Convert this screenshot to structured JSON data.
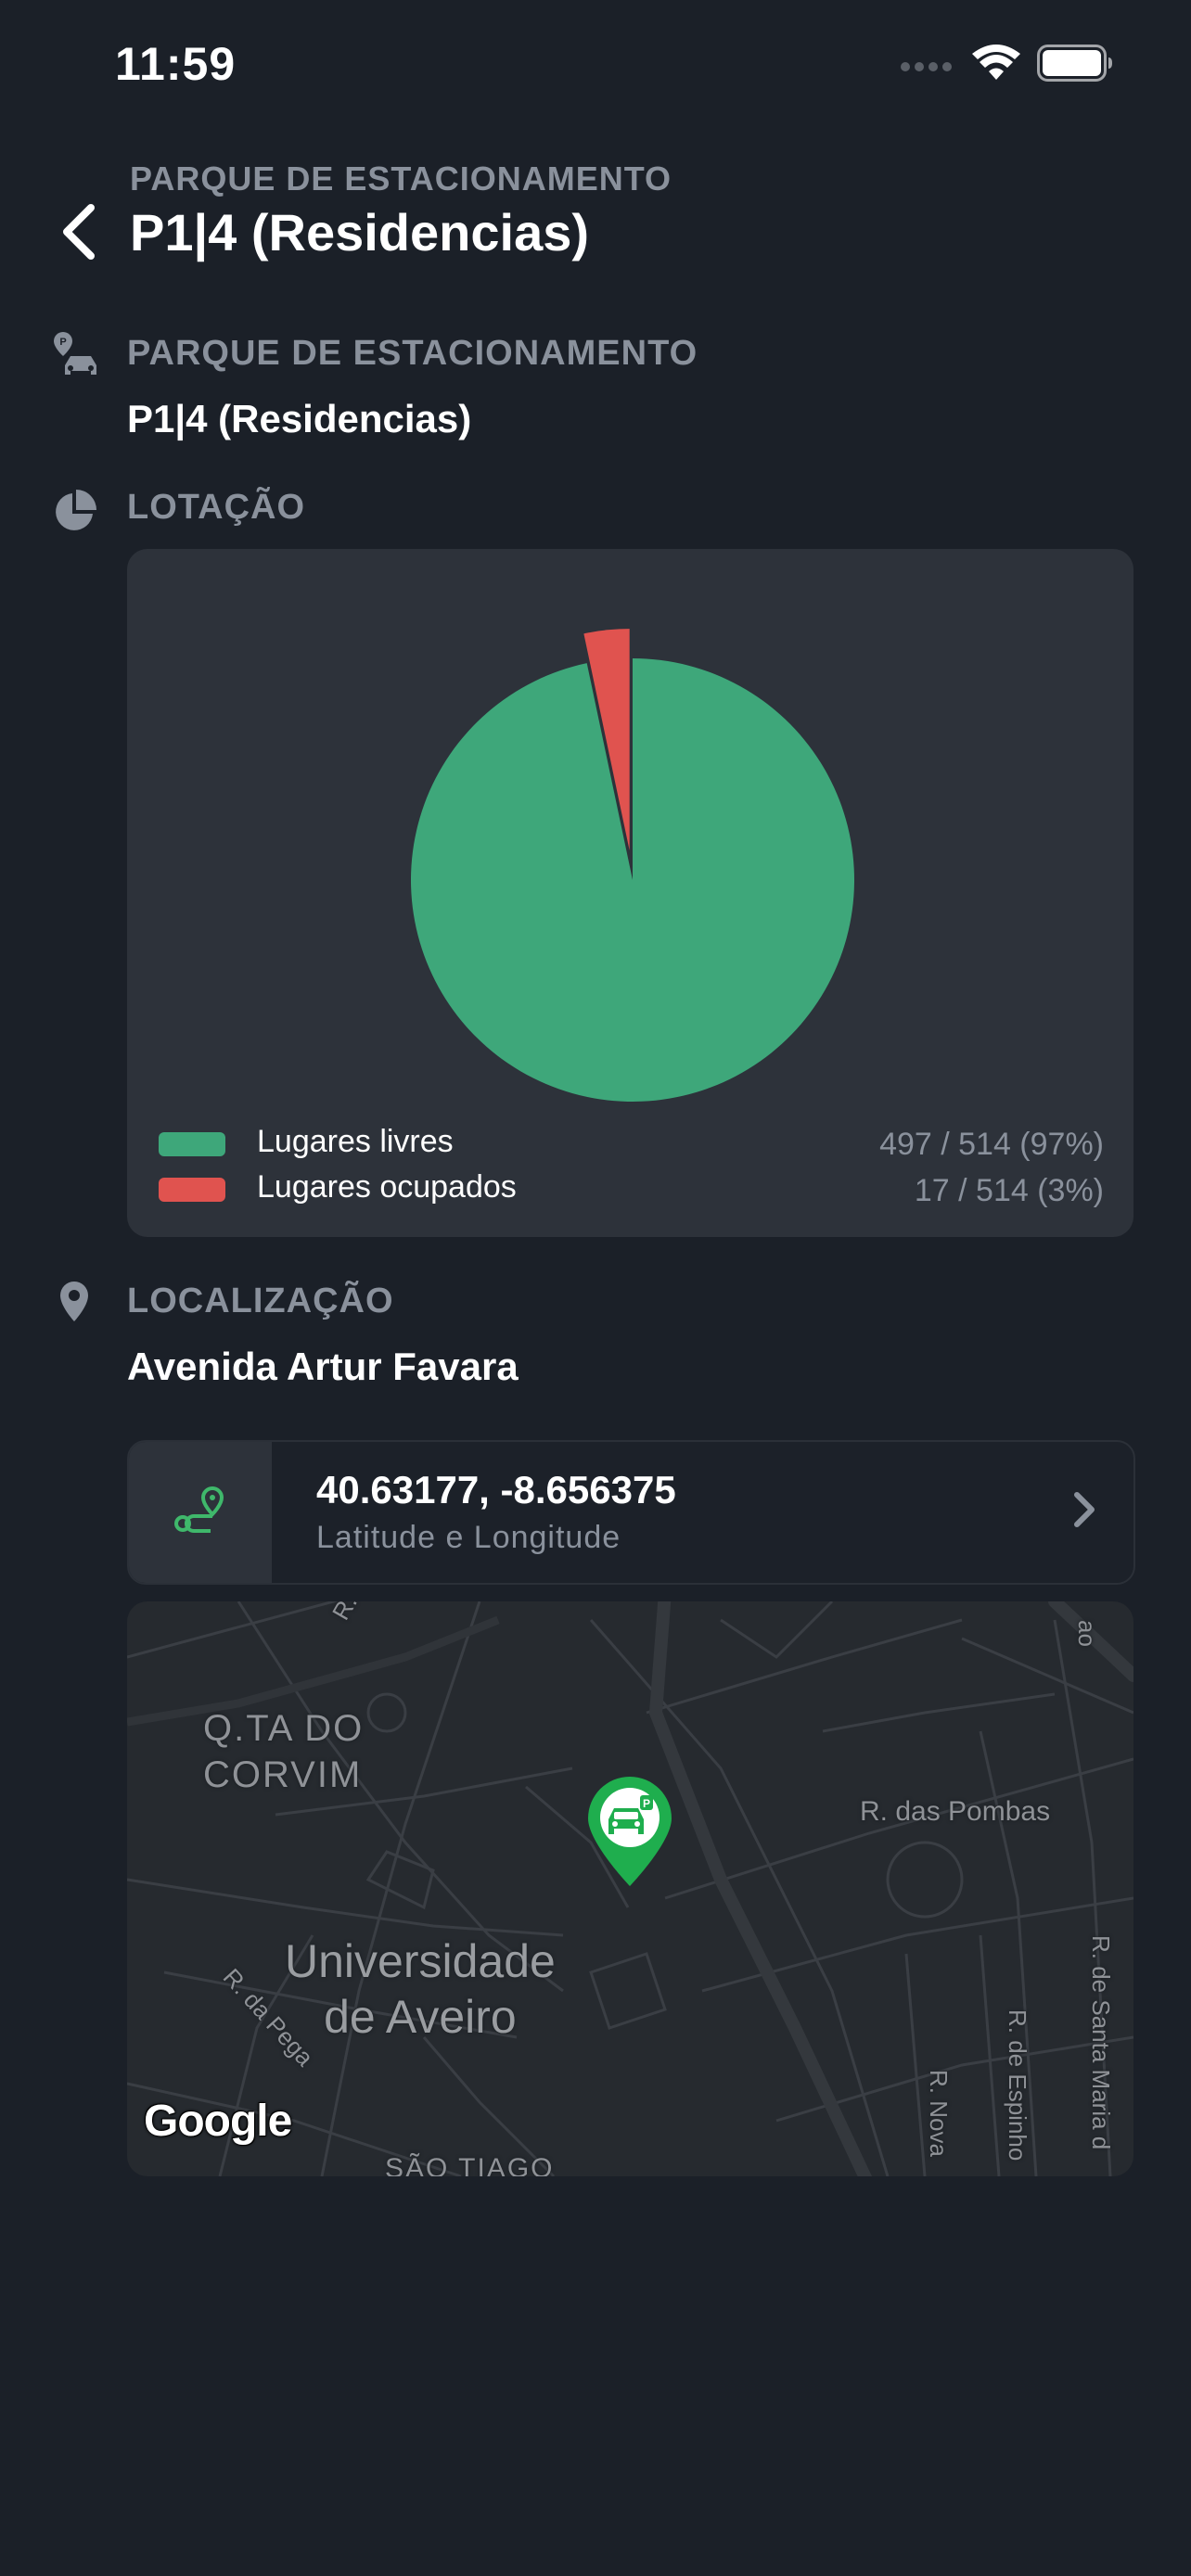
{
  "status_bar": {
    "time": "11:59"
  },
  "header": {
    "subtitle": "PARQUE DE ESTACIONAMENTO",
    "title": "P1|4 (Residencias)"
  },
  "parking": {
    "label": "PARQUE DE ESTACIONAMENTO",
    "value": "P1|4 (Residencias)"
  },
  "occupancy": {
    "label": "LOTAÇÃO",
    "legend": [
      {
        "label": "Lugares livres",
        "value": "497 / 514 (97%)",
        "color": "#3ea77a"
      },
      {
        "label": "Lugares ocupados",
        "value": "17 / 514 (3%)",
        "color": "#e0534f"
      }
    ]
  },
  "chart_data": {
    "type": "pie",
    "slices": [
      {
        "label": "Lugares livres",
        "value": 497,
        "color": "#3ea77a"
      },
      {
        "label": "Lugares ocupados",
        "value": 17,
        "color": "#e0534f"
      }
    ],
    "total": 514
  },
  "location": {
    "label": "LOCALIZAÇÃO",
    "address": "Avenida Artur Favara",
    "coordinates": "40.63177, -8.656375",
    "coordinates_caption": "Latitude e Longitude"
  },
  "map": {
    "labels": {
      "district": "Q.TA DO CORVIM",
      "university_line1": "Universidade",
      "university_line2": "de Aveiro",
      "street_pombas": "R. das Pombas",
      "street_pega": "R. da Pega",
      "street_nova": "R. Nova",
      "street_espinho": "R. de Espinho",
      "street_santa_maria": "R. de Santa Maria d",
      "street_top_left": "R. da",
      "street_top_right": "ao",
      "sao_tiago": "SÃO TIAGO",
      "google": "Google"
    },
    "pin_icon": "parking-car-pin-icon"
  }
}
